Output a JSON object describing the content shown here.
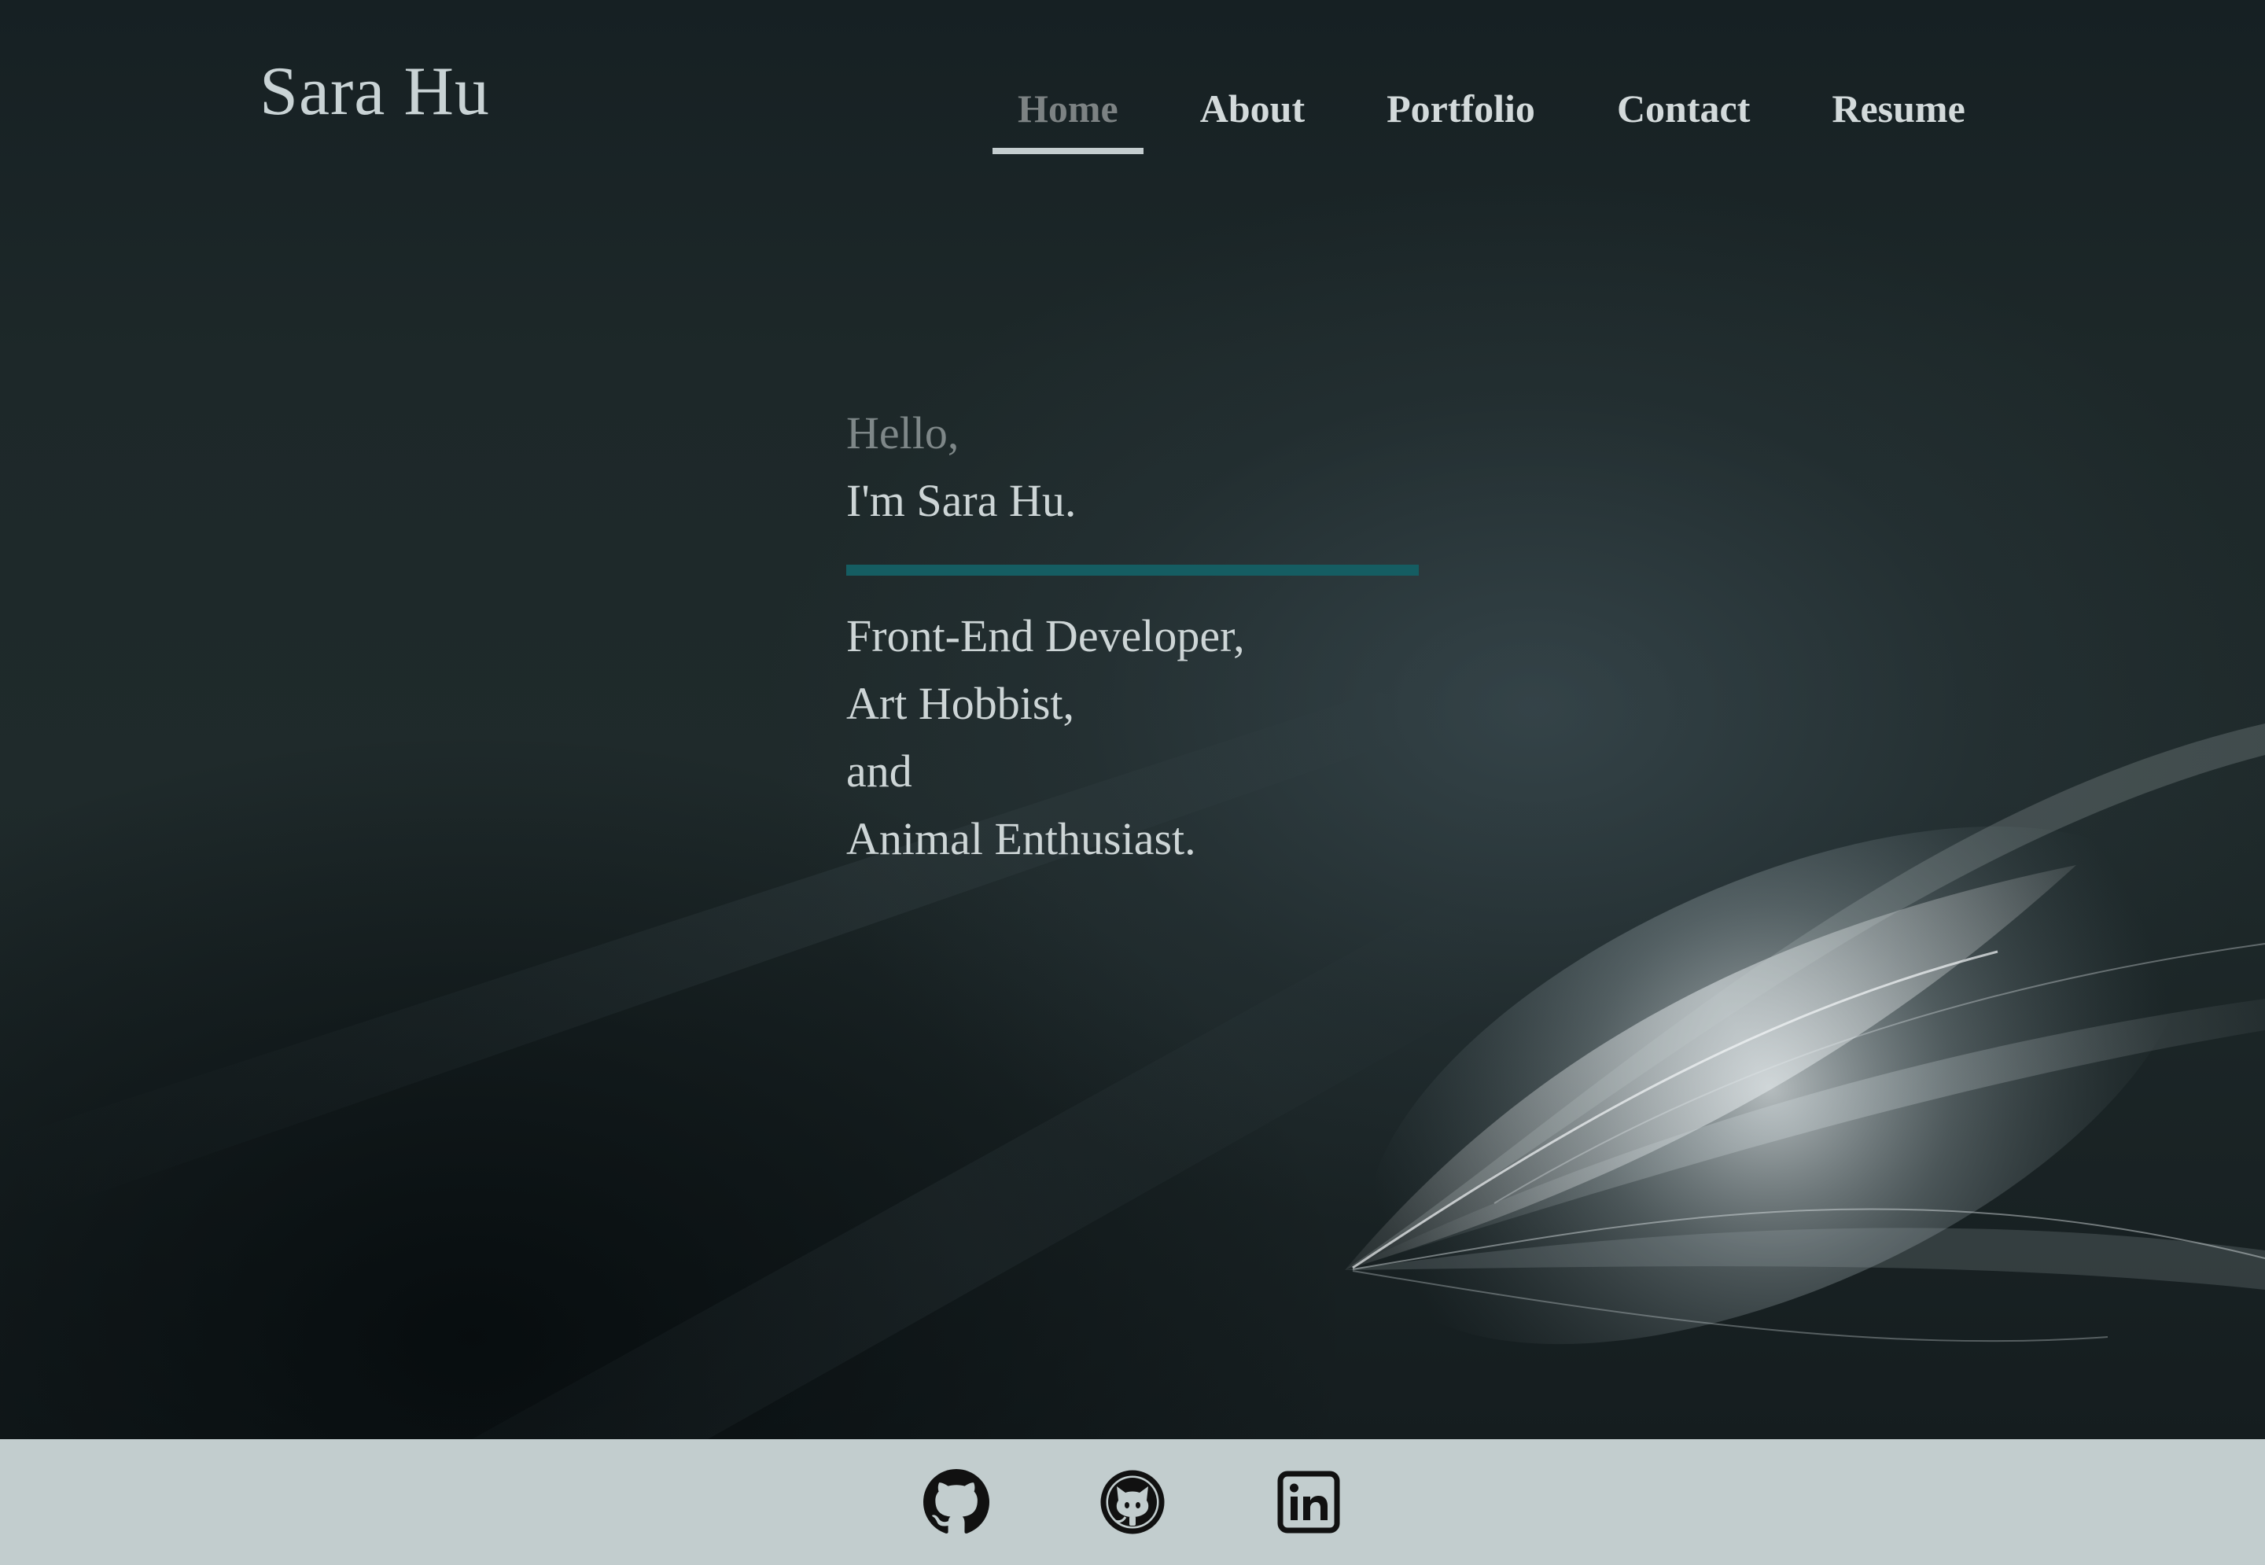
{
  "header": {
    "brand": "Sara Hu",
    "nav": [
      {
        "label": "Home",
        "active": true
      },
      {
        "label": "About",
        "active": false
      },
      {
        "label": "Portfolio",
        "active": false
      },
      {
        "label": "Contact",
        "active": false
      },
      {
        "label": "Resume",
        "active": false
      }
    ]
  },
  "intro": {
    "greeting": "Hello,",
    "name_line": "I'm Sara Hu.",
    "roles": [
      "Front-End Developer,",
      "Art Hobbist,",
      "and",
      "Animal Enthusiast."
    ]
  },
  "footer": {
    "links": [
      {
        "icon": "github-icon"
      },
      {
        "icon": "github-octocat-icon"
      },
      {
        "icon": "linkedin-icon"
      }
    ]
  },
  "colors": {
    "accent": "#155d62",
    "footer_bg": "#c2cdce",
    "text_light": "#cdd5d6",
    "text_muted": "#7e8788"
  }
}
